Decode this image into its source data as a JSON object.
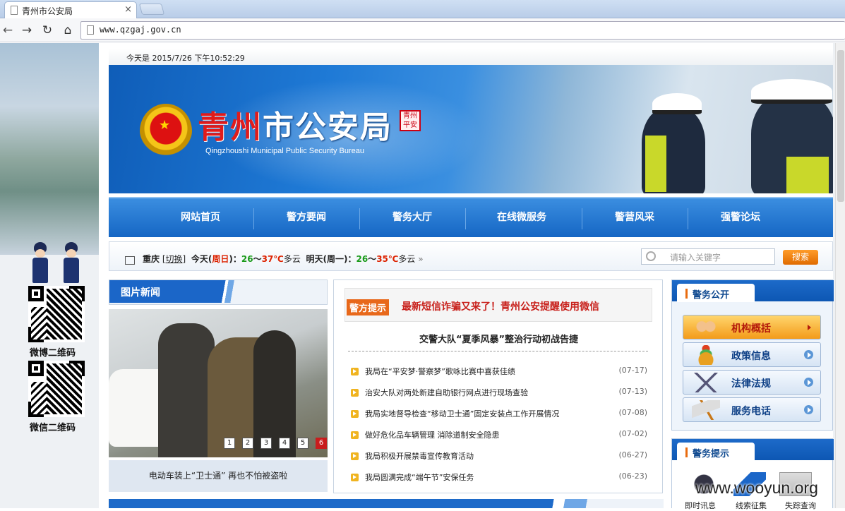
{
  "browser": {
    "tab_title": "青州市公安局",
    "tab_close": "×",
    "url": "www.qzgaj.gov.cn",
    "nav": {
      "back": "←",
      "forward": "→",
      "reload": "↻",
      "home": "⌂"
    }
  },
  "datebar": {
    "text": "今天是 2015/7/26 下午10:52:29"
  },
  "banner": {
    "title_red": "青州",
    "title_white": "市公安局",
    "seal_text": "青州平安",
    "subtitle": "Qingzhoushi Municipal Public Security Bureau"
  },
  "menu": [
    "网站首页",
    "警方要闻",
    "警务大厅",
    "在线微服务",
    "警营风采",
    "强警论坛"
  ],
  "weather": {
    "city": "重庆",
    "switch": "[切换]",
    "today_prefix": "今天(",
    "today_day": "周日",
    "today_suffix": ")：",
    "today_low": "26",
    "today_sep": "～",
    "today_high": "37℃",
    "today_cond": "多云",
    "tomorrow_prefix": "明天(周一)：",
    "tomorrow_low": "26",
    "tomorrow_sep": "～",
    "tomorrow_high": "35℃",
    "tomorrow_cond": "多云",
    "more": "»"
  },
  "search": {
    "placeholder": "请输入关键字",
    "button": "搜索"
  },
  "photo_news": {
    "heading": "图片新闻",
    "caption": "电动车装上“卫士通”  再也不怕被盗啦",
    "pages": [
      "1",
      "2",
      "3",
      "4",
      "5",
      "6"
    ],
    "active_page": "6"
  },
  "alert": {
    "label": "警方提示",
    "text": "最新短信诈骗又来了！青州公安提醒使用微信"
  },
  "headline": "交警大队“夏季风暴”整治行动初战告捷",
  "news": [
    {
      "title": "我局在“平安梦·警察梦”歌咏比赛中喜获佳绩",
      "date": "(07-17)"
    },
    {
      "title": "治安大队对两处新建自助银行网点进行现场查验",
      "date": "(07-13)"
    },
    {
      "title": "我局实地督导检查“移动卫士通”固定安装点工作开展情况",
      "date": "(07-08)"
    },
    {
      "title": "做好危化品车辆管理 消除道制安全隐患",
      "date": "(07-02)"
    },
    {
      "title": "我局积极开展禁毒宣传教育活动",
      "date": "(06-27)"
    },
    {
      "title": "我局圆满完成“端午节”安保任务",
      "date": "(06-23)"
    }
  ],
  "police_affairs": {
    "heading": "警务公开",
    "items": [
      "机构概括",
      "政策信息",
      "法律法规",
      "服务电话"
    ]
  },
  "police_tips": {
    "heading": "警务提示",
    "items": [
      "即时讯息",
      "线索征集",
      "失踪查询"
    ]
  },
  "sidebar": {
    "weibo_qr": "微博二维码",
    "weixin_qr": "微信二维码"
  },
  "watermark": "www.wooyun.org",
  "colors": {
    "primary_blue": "#1566c4",
    "accent_orange": "#e8681a",
    "alert_red": "#c8201b"
  }
}
